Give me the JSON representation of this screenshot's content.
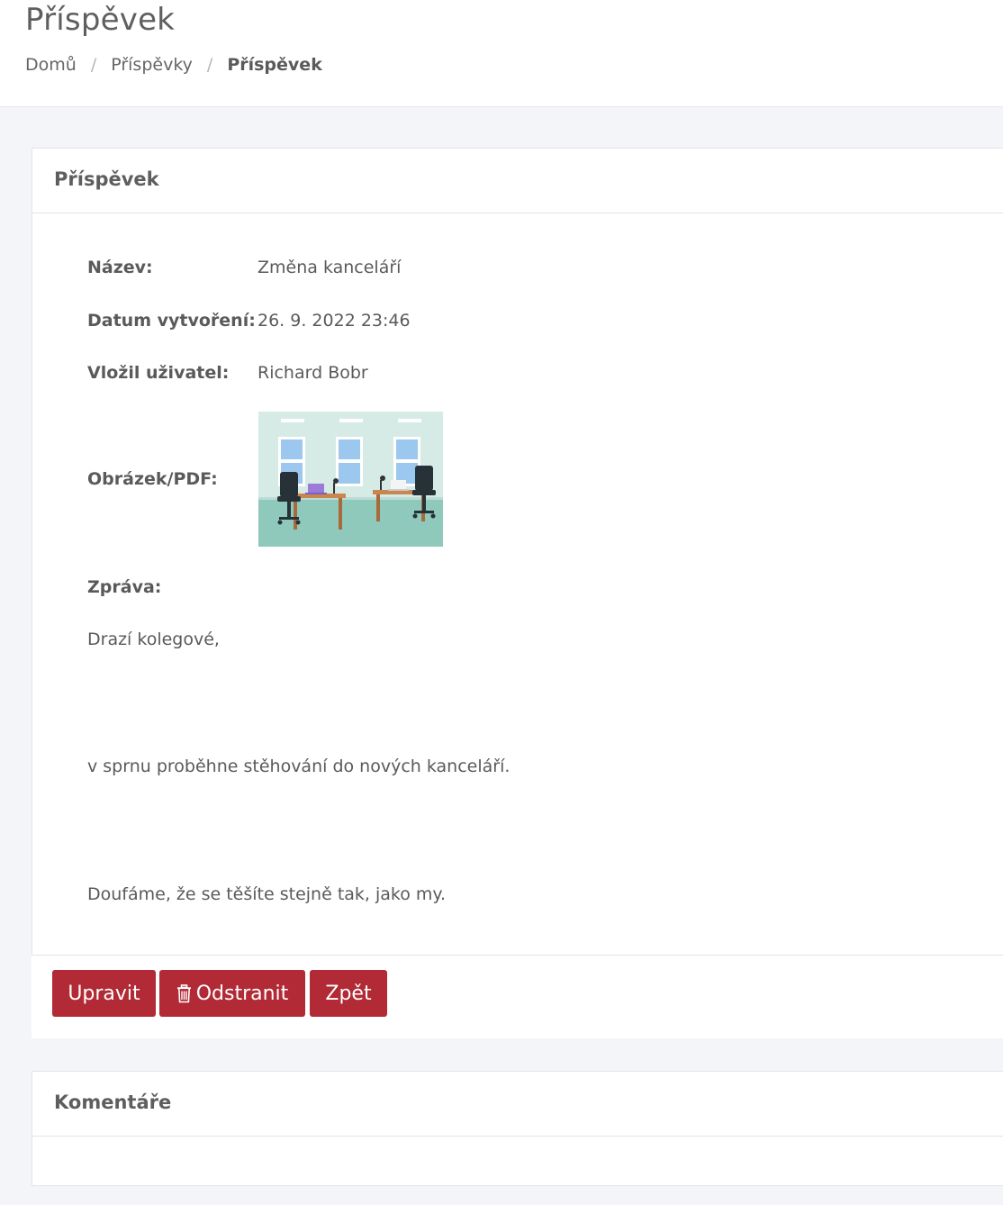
{
  "header": {
    "title": "Příspěvek",
    "breadcrumb": [
      {
        "label": "Domů"
      },
      {
        "label": "Příspěvky"
      },
      {
        "label": "Příspěvek"
      }
    ],
    "breadcrumb_separator": "/"
  },
  "post_card": {
    "title": "Příspěvek",
    "fields": {
      "name_label": "Název:",
      "name_value": "Změna kanceláří",
      "created_label": "Datum vytvoření:",
      "created_value": "26. 9. 2022 23:46",
      "author_label": "Vložil uživatel:",
      "author_value": "Richard Bobr",
      "attachment_label": "Obrázek/PDF:",
      "message_label": "Zpráva:"
    },
    "message_lines": [
      "Drazí kolegové,",
      "v sprnu proběhne stěhování do nových kanceláří.",
      "Doufáme, že se těšíte stejně tak, jako my."
    ]
  },
  "actions": {
    "edit_label": "Upravit",
    "delete_label": "Odstranit",
    "back_label": "Zpět",
    "delete_icon": "trash-icon",
    "button_color": "#b12a35"
  },
  "comments_card": {
    "title": "Komentáře"
  }
}
